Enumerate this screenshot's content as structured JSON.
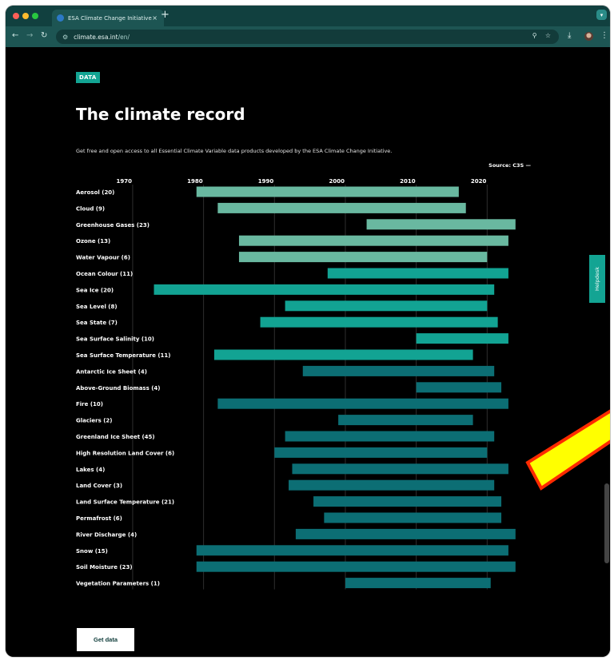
{
  "browser": {
    "tab_title": "ESA Climate Change Initiative",
    "tab_close": "×",
    "new_tab": "+",
    "url_host": "climate.esa.int",
    "url_path": "/en/",
    "menu_icon": "chevron-down-icon",
    "colors": {
      "tabbar": "#11403f",
      "toolbar": "#1d5553"
    }
  },
  "page": {
    "badge": "DATA",
    "title": "The climate record",
    "description": "Get free and open access to all Essential Climate Variable data products developed by the ESA Climate Change Initiative.",
    "source_label": "Source: C3S —",
    "get_data_label": "Get data",
    "helpdesk_label": "Helpdesk"
  },
  "annotation": {
    "type": "arrow",
    "color": "#ffff00",
    "outline": "#ff2a00"
  },
  "chart_data": {
    "type": "bar",
    "orientation": "horizontal-range",
    "xlim": [
      1962,
      2030
    ],
    "xticks": [
      1970,
      1980,
      1990,
      2000,
      2010,
      2020
    ],
    "grid": true,
    "colors": {
      "light": "#69b8a0",
      "mid": "#12a393",
      "dark": "#0c6e74"
    },
    "series": [
      {
        "label": "Aerosol (20)",
        "start": 1979,
        "end": 2016,
        "color": "light"
      },
      {
        "label": "Cloud (9)",
        "start": 1982,
        "end": 2017,
        "color": "light"
      },
      {
        "label": "Greenhouse Gases (23)",
        "start": 2003,
        "end": 2024,
        "color": "light"
      },
      {
        "label": "Ozone (13)",
        "start": 1985,
        "end": 2023,
        "color": "light"
      },
      {
        "label": "Water Vapour (6)",
        "start": 1985,
        "end": 2020,
        "color": "light"
      },
      {
        "label": "Ocean Colour (11)",
        "start": 1997.5,
        "end": 2023,
        "color": "mid"
      },
      {
        "label": "Sea Ice (20)",
        "start": 1973,
        "end": 2021,
        "color": "mid"
      },
      {
        "label": "Sea Level (8)",
        "start": 1991.5,
        "end": 2020,
        "color": "mid"
      },
      {
        "label": "Sea State (7)",
        "start": 1988,
        "end": 2021.5,
        "color": "mid"
      },
      {
        "label": "Sea Surface Salinity (10)",
        "start": 2010,
        "end": 2023,
        "color": "mid"
      },
      {
        "label": "Sea Surface Temperature (11)",
        "start": 1981.5,
        "end": 2018,
        "color": "mid"
      },
      {
        "label": "Antarctic Ice Sheet (4)",
        "start": 1994,
        "end": 2021,
        "color": "dark"
      },
      {
        "label": "Above-Ground Biomass (4)",
        "start": 2010,
        "end": 2022,
        "color": "dark"
      },
      {
        "label": "Fire (10)",
        "start": 1982,
        "end": 2023,
        "color": "dark"
      },
      {
        "label": "Glaciers (2)",
        "start": 1999,
        "end": 2018,
        "color": "dark"
      },
      {
        "label": "Greenland Ice Sheet (45)",
        "start": 1991.5,
        "end": 2021,
        "color": "dark"
      },
      {
        "label": "High Resolution Land Cover (6)",
        "start": 1990,
        "end": 2020,
        "color": "dark"
      },
      {
        "label": "Lakes (4)",
        "start": 1992.5,
        "end": 2023,
        "color": "dark"
      },
      {
        "label": "Land Cover (3)",
        "start": 1992,
        "end": 2021,
        "color": "dark"
      },
      {
        "label": "Land Surface Temperature (21)",
        "start": 1995.5,
        "end": 2022,
        "color": "dark"
      },
      {
        "label": "Permafrost (6)",
        "start": 1997,
        "end": 2022,
        "color": "dark"
      },
      {
        "label": "River Discharge (4)",
        "start": 1993,
        "end": 2024,
        "color": "dark"
      },
      {
        "label": "Snow (15)",
        "start": 1979,
        "end": 2023,
        "color": "dark"
      },
      {
        "label": "Soil Moisture (23)",
        "start": 1979,
        "end": 2024,
        "color": "dark"
      },
      {
        "label": "Vegetation Parameters (1)",
        "start": 2000,
        "end": 2020.5,
        "color": "dark"
      }
    ]
  }
}
